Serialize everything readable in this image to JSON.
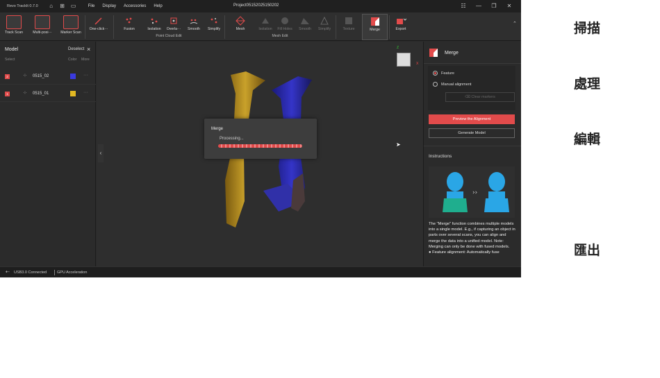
{
  "window": {
    "app_name": "Revo TrackIt 0.7.0",
    "project_title": "Project05152025150202",
    "menu": [
      "File",
      "Display",
      "Accessories",
      "Help"
    ]
  },
  "toolbar": {
    "scan_tools": [
      "Track Scan",
      "Multi-posi···",
      "Marker Scan",
      "One-click···"
    ],
    "point_cloud_tools": [
      "Fusion",
      "Isolation",
      "Overla···",
      "Smooth",
      "Simplify"
    ],
    "point_cloud_group": "Point Cloud Edit",
    "mesh_tools": [
      "Mesh",
      "Isolation",
      "Fill Holes",
      "Smooth",
      "Simplify"
    ],
    "mesh_group": "Mesh Edit",
    "texture_label": "Texture",
    "merge_label": "Merge",
    "export_label": "Export"
  },
  "sidebar": {
    "title": "Model",
    "deselect": "Deselect",
    "col_select": "Select",
    "col_color": "Color",
    "col_more": "More",
    "rows": [
      {
        "index": "2",
        "name": "0515_02",
        "color": "#3a3adf"
      },
      {
        "index": "1",
        "name": "0515_01",
        "color": "#e2b822"
      }
    ]
  },
  "dialog": {
    "title": "Merge",
    "status": "Processing..."
  },
  "merge_panel": {
    "title": "Merge",
    "option_feature": "Feature",
    "option_manual": "Manual alignment",
    "clear_markers": "Clear markers",
    "preview_button": "Preview the Alignment",
    "generate_button": "Generate Model",
    "instructions_title": "Instructions",
    "instructions_text": "The \"Merge\" function combines multiple models into a single model. E.g., if capturing an object in parts over several scans, you can align and merge the data into a unified model. Note: Merging can only be done with fused models.",
    "instructions_bullet": "● Feature alignment: Automatically fuse"
  },
  "status_bar": {
    "connection": "USB3.0 Connected",
    "gpu": "GPU Acceleration"
  },
  "side_labels": [
    "掃描",
    "處理",
    "編輯",
    "匯出"
  ],
  "colors": {
    "accent": "#e24b4b",
    "model_blue": "#3a3adf",
    "model_yellow": "#e2b822"
  }
}
